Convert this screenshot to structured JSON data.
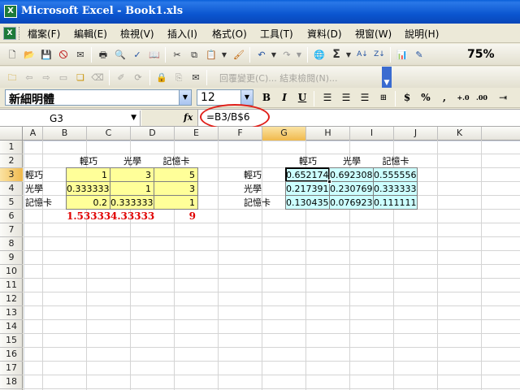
{
  "window": {
    "title": "Microsoft Excel - Book1.xls",
    "app_icon": "excel-icon"
  },
  "menu": {
    "items": [
      "檔案(F)",
      "編輯(E)",
      "檢視(V)",
      "插入(I)",
      "格式(O)",
      "工具(T)",
      "資料(D)",
      "視窗(W)",
      "說明(H)"
    ]
  },
  "toolbar": {
    "zoom": "75%",
    "reply_with_changes": "回覆變更(C)... 結束檢閱(N)..."
  },
  "format": {
    "font_name": "新細明體",
    "font_size": "12"
  },
  "formula_bar": {
    "name_box": "G3",
    "fx_label": "fx",
    "formula": "=B3/B$6"
  },
  "columns": [
    "A",
    "B",
    "C",
    "D",
    "E",
    "F",
    "G",
    "H",
    "I",
    "J",
    "K"
  ],
  "active_column": "G",
  "rows": [
    "1",
    "2",
    "3",
    "4",
    "5",
    "6",
    "7",
    "8",
    "9",
    "10",
    "11",
    "12",
    "13",
    "14",
    "15",
    "16",
    "17",
    "18"
  ],
  "active_row": "3",
  "sheet": {
    "left_table": {
      "headers": [
        "輕巧",
        "光學",
        "記憶卡"
      ],
      "row_labels": [
        "輕巧",
        "光學",
        "記憶卡"
      ],
      "values": [
        [
          "1",
          "3",
          "5"
        ],
        [
          "0.333333",
          "1",
          "3"
        ],
        [
          "0.2",
          "0.333333",
          "1"
        ]
      ],
      "totals": [
        "1.53333",
        "4.33333",
        "9"
      ]
    },
    "right_table": {
      "headers": [
        "輕巧",
        "光學",
        "記憶卡"
      ],
      "row_labels": [
        "輕巧",
        "光學",
        "記憶卡"
      ],
      "values": [
        [
          "0.652174",
          "0.692308",
          "0.555556"
        ],
        [
          "0.217391",
          "0.230769",
          "0.333333"
        ],
        [
          "0.130435",
          "0.076923",
          "0.111111"
        ]
      ]
    }
  },
  "colors": {
    "input_fill": "#ffff99",
    "result_fill": "#ccffff",
    "total_text": "#e00000",
    "annotation_circle": "#e0201a"
  }
}
